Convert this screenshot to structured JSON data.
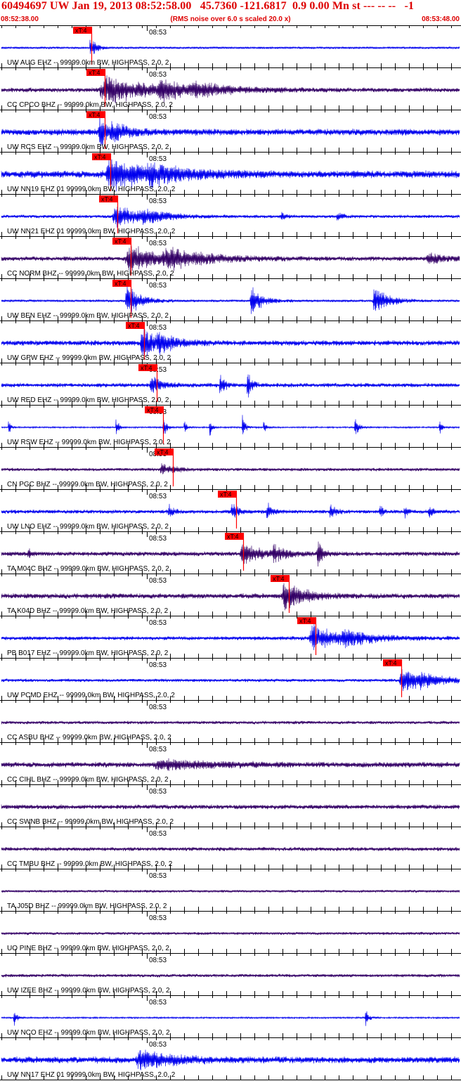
{
  "header": {
    "title": "60494697 UW Jan 19, 2013 08:52:58.00   45.7360 -121.6817  0.9 0.00 Mn st --- -- --   -1",
    "time_start": "08:52:38.00",
    "rms_note": "(RMS noise over 6.0 s scaled 20.0 x)",
    "time_end": "08:53:48.00"
  },
  "colors": {
    "header_text": "#dd0000",
    "pick": "#ff0000",
    "trace_blue": "#0000ee",
    "trace_navy": "#330066",
    "grid": "#000000"
  },
  "chart_data": {
    "type": "line",
    "x_range": [
      "08:52:38.00",
      "08:53:48.00"
    ],
    "tick_label": "08:53",
    "pick_label": "xT:4",
    "traces": [
      {
        "label": "UW AUG EHZ -- 99999.0km BW, HIGHPASS, 2.0, 2",
        "color": "#0000ee",
        "pick": 104,
        "noise": 0.07,
        "bursts": [
          [
            128,
            0.6,
            4
          ],
          [
            133,
            0.3,
            8
          ]
        ]
      },
      {
        "label": "CC CPCO BHZ -- 99999.0km BW, HIGHPASS, 2.0, 2",
        "color": "#330066",
        "pick": 123,
        "noise": 0.14,
        "bursts": [
          [
            150,
            0.95,
            55
          ],
          [
            230,
            0.5,
            40
          ],
          [
            280,
            0.3,
            50
          ]
        ]
      },
      {
        "label": "UW RCS EHZ -- 99999.0km BW, HIGHPASS, 2.0, 2",
        "color": "#0000ee",
        "pick": 123,
        "noise": 0.2,
        "bursts": [
          [
            142,
            0.9,
            14
          ],
          [
            160,
            0.4,
            25
          ]
        ]
      },
      {
        "label": "UW NN19 EHZ 01 99999.0km BW, HIGHPASS, 2.0, 2",
        "color": "#0000ee",
        "pick": 131,
        "noise": 0.22,
        "bursts": [
          [
            158,
            0.95,
            50
          ],
          [
            215,
            0.45,
            50
          ]
        ]
      },
      {
        "label": "UW NN21 EHZ 01 99999.0km BW, HIGHPASS, 2.0, 2",
        "color": "#0000ee",
        "pick": 141,
        "noise": 0.1,
        "bursts": [
          [
            165,
            0.7,
            35
          ],
          [
            205,
            0.35,
            30
          ],
          [
            400,
            0.25,
            8
          ],
          [
            480,
            0.25,
            8
          ]
        ]
      },
      {
        "label": "CC NORM BHZ -- 99999.0km BW, HIGHPASS, 2.0, 2",
        "color": "#330066",
        "pick": 160,
        "noise": 0.14,
        "bursts": [
          [
            185,
            0.75,
            45
          ],
          [
            240,
            0.5,
            60
          ],
          [
            610,
            0.3,
            25
          ]
        ]
      },
      {
        "label": "UW BEN EHZ -- 99999.0km BW, HIGHPASS, 2.0, 2",
        "color": "#0000ee",
        "pick": 160,
        "noise": 0.08,
        "bursts": [
          [
            181,
            1,
            18
          ],
          [
            358,
            1,
            14
          ],
          [
            533,
            1,
            18
          ]
        ]
      },
      {
        "label": "UW GPW EHZ -- 99999.0km BW, HIGHPASS, 2.0, 2",
        "color": "#0000ee",
        "pick": 179,
        "noise": 0.16,
        "bursts": [
          [
            202,
            1,
            18
          ],
          [
            226,
            0.5,
            25
          ]
        ]
      },
      {
        "label": "UW RED EHZ -- 99999.0km BW, HIGHPASS, 2.0, 2",
        "color": "#0000ee",
        "pick": 197,
        "noise": 0.13,
        "bursts": [
          [
            215,
            0.65,
            12
          ],
          [
            313,
            1,
            5
          ],
          [
            352,
            1,
            5
          ]
        ]
      },
      {
        "label": "UW RSW EHZ -- 99999.0km BW, HIGHPASS, 2.0, 2",
        "color": "#0000ee",
        "pick": 206,
        "noise": 0.05,
        "bursts": [
          [
            12,
            0.6,
            3
          ],
          [
            165,
            0.8,
            3
          ],
          [
            232,
            0.9,
            4
          ],
          [
            262,
            0.5,
            3
          ],
          [
            298,
            0.7,
            3
          ],
          [
            345,
            0.8,
            4
          ],
          [
            375,
            0.5,
            3
          ],
          [
            505,
            0.8,
            5
          ],
          [
            625,
            0.6,
            3
          ]
        ]
      },
      {
        "label": "CN PGC BHZ -- 99999.0km BW, HIGHPASS, 2.0, 2",
        "color": "#330066",
        "pick": 220,
        "noise": 0.1,
        "bursts": [
          [
            230,
            0.3,
            20
          ]
        ]
      },
      {
        "label": "UW LNO EHZ -- 99999.0km BW, HIGHPASS, 2.0, 2",
        "color": "#0000ee",
        "pick": 310,
        "noise": 0.12,
        "bursts": [
          [
            240,
            0.5,
            5
          ],
          [
            330,
            0.6,
            8
          ],
          [
            380,
            0.6,
            6
          ],
          [
            470,
            0.6,
            6
          ],
          [
            540,
            0.5,
            4
          ],
          [
            575,
            0.5,
            4
          ],
          [
            610,
            0.6,
            4
          ]
        ]
      },
      {
        "label": "TA M04C BHZ -- 99999.0km BW, HIGHPASS, 2.0, 2",
        "color": "#330066",
        "pick": 320,
        "noise": 0.14,
        "bursts": [
          [
            40,
            0.35,
            4
          ],
          [
            345,
            0.7,
            25
          ],
          [
            390,
            0.45,
            15
          ],
          [
            452,
            0.9,
            7
          ]
        ]
      },
      {
        "label": "TA K04D BHZ -- 99999.0km BW, HIGHPASS, 2.0, 2",
        "color": "#330066",
        "pick": 385,
        "noise": 0.16,
        "bursts": [
          [
            405,
            1,
            25
          ]
        ]
      },
      {
        "label": "PB B017 EHZ -- 99999.0km BW, HIGHPASS, 2.0, 2",
        "color": "#0000ee",
        "pick": 423,
        "noise": 0.12,
        "bursts": [
          [
            445,
            0.8,
            35
          ],
          [
            490,
            0.4,
            40
          ]
        ]
      },
      {
        "label": "UW PCMD EHZ -- 99999.0km BW, HIGHPASS, 2.0, 2",
        "color": "#0000ee",
        "pick": 545,
        "noise": 0.1,
        "bursts": [
          [
            572,
            0.85,
            25
          ],
          [
            600,
            0.35,
            30
          ]
        ]
      },
      {
        "label": "CC ASBU BHZ -- 99999.0km BW, HIGHPASS, 2.0, 2",
        "color": "#330066",
        "pick": null,
        "noise": 0.1,
        "bursts": []
      },
      {
        "label": "CC CIHL BHZ -- 99999.0km BW, HIGHPASS, 2.0, 2",
        "color": "#330066",
        "pick": null,
        "noise": 0.16,
        "bursts": [
          [
            230,
            0.3,
            80
          ]
        ]
      },
      {
        "label": "CC SWNB BHZ -- 99999.0km BW, HIGHPASS, 2.0, 2",
        "color": "#330066",
        "pick": null,
        "noise": 0.14,
        "bursts": []
      },
      {
        "label": "CC TMBU BHZ -- 99999.0km BW, HIGHPASS, 2.0, 2",
        "color": "#330066",
        "pick": null,
        "noise": 0.12,
        "bursts": []
      },
      {
        "label": "TA J05D BHZ -- 99999.0km BW, HIGHPASS, 2.0, 2",
        "color": "#330066",
        "pick": null,
        "noise": 0.08,
        "bursts": []
      },
      {
        "label": "UO PINE BHZ -- 99999.0km BW, HIGHPASS, 2.0, 2",
        "color": "#330066",
        "pick": null,
        "noise": 0.09,
        "bursts": []
      },
      {
        "label": "UW IZEE BHZ -- 99999.0km BW, HIGHPASS, 2.0, 2",
        "color": "#330066",
        "pick": null,
        "noise": 0.1,
        "bursts": []
      },
      {
        "label": "UW NCO EHZ -- 99999.0km BW, HIGHPASS, 2.0, 2",
        "color": "#0000ee",
        "pick": null,
        "noise": 0.05,
        "bursts": [
          [
            20,
            0.5,
            5
          ],
          [
            520,
            0.6,
            4
          ]
        ]
      },
      {
        "label": "UW NN17 EHZ 01 99999.0km BW, HIGHPASS, 2.0, 2",
        "color": "#0000ee",
        "pick": null,
        "noise": 0.2,
        "bursts": [
          [
            200,
            0.55,
            45
          ]
        ]
      }
    ]
  }
}
